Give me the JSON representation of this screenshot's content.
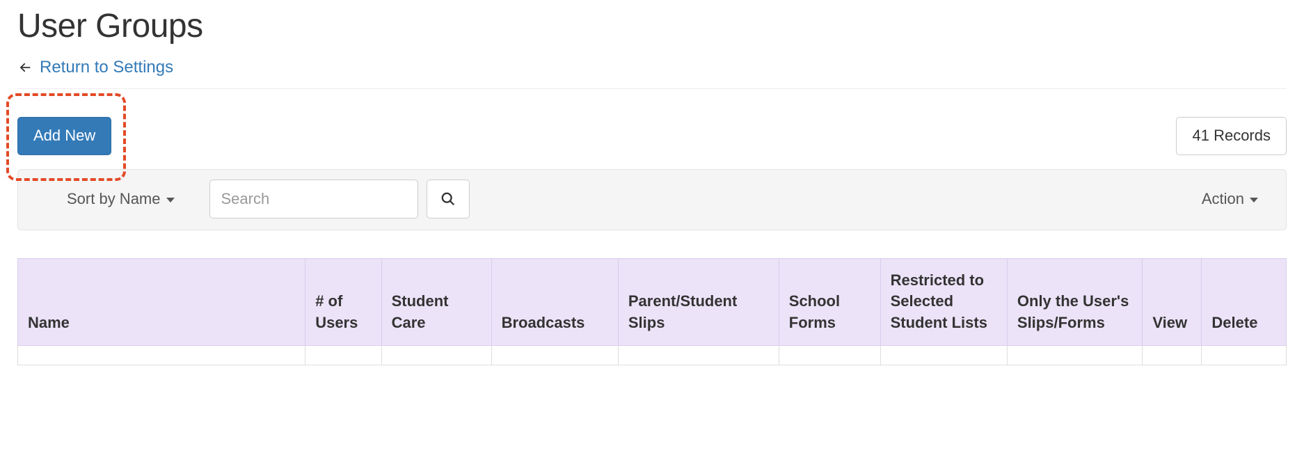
{
  "header": {
    "title": "User Groups",
    "return_label": "Return to Settings"
  },
  "toolbar": {
    "add_new_label": "Add New",
    "records_label": "41 Records"
  },
  "filter": {
    "sort_label": "Sort by Name",
    "search_placeholder": "Search",
    "action_label": "Action"
  },
  "table": {
    "columns": {
      "name": "Name",
      "users": "# of Users",
      "care": "Student Care",
      "broadcasts": "Broadcasts",
      "slips": "Parent/Student Slips",
      "forms": "School Forms",
      "restricted": "Restricted to Selected Student Lists",
      "only": "Only the User's Slips/Forms",
      "view": "View",
      "delete": "Delete"
    }
  }
}
